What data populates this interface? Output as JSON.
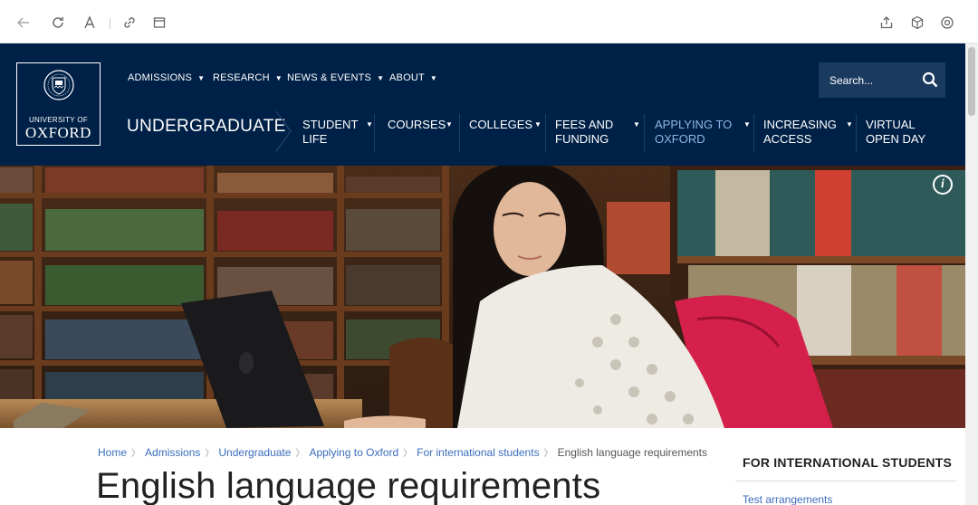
{
  "browser": {
    "icons": [
      "back-arrow-icon",
      "refresh-icon",
      "reader-font-icon",
      "link-icon",
      "calendar-icon",
      "share-icon",
      "cube-icon",
      "settings-circle-icon"
    ]
  },
  "logo": {
    "line1": "UNIVERSITY OF",
    "line2": "OXFORD"
  },
  "top_nav": [
    {
      "label": "ADMISSIONS"
    },
    {
      "label": "RESEARCH"
    },
    {
      "label": "NEWS & EVENTS"
    },
    {
      "label": "ABOUT"
    }
  ],
  "search": {
    "placeholder": "Search..."
  },
  "section_title": "UNDERGRADUATE",
  "main_nav": [
    {
      "line1": "STUDENT",
      "line2": "LIFE"
    },
    {
      "line1": "COURSES",
      "line2": ""
    },
    {
      "line1": "COLLEGES",
      "line2": ""
    },
    {
      "line1": "FEES AND",
      "line2": "FUNDING"
    },
    {
      "line1": "APPLYING TO",
      "line2": "OXFORD"
    },
    {
      "line1": "INCREASING",
      "line2": "ACCESS"
    },
    {
      "line1": "VIRTUAL",
      "line2": "OPEN DAY"
    }
  ],
  "breadcrumb": [
    "Home",
    "Admissions",
    "Undergraduate",
    "Applying to Oxford",
    "For international students",
    "English language requirements"
  ],
  "page_title": "English language requirements",
  "sidebar": {
    "title": "FOR INTERNATIONAL STUDENTS",
    "links": [
      "Test arrangements"
    ]
  },
  "colors": {
    "navy": "#002147",
    "link_blue": "#3b6dbb",
    "active_nav": "#8fb4e6"
  }
}
